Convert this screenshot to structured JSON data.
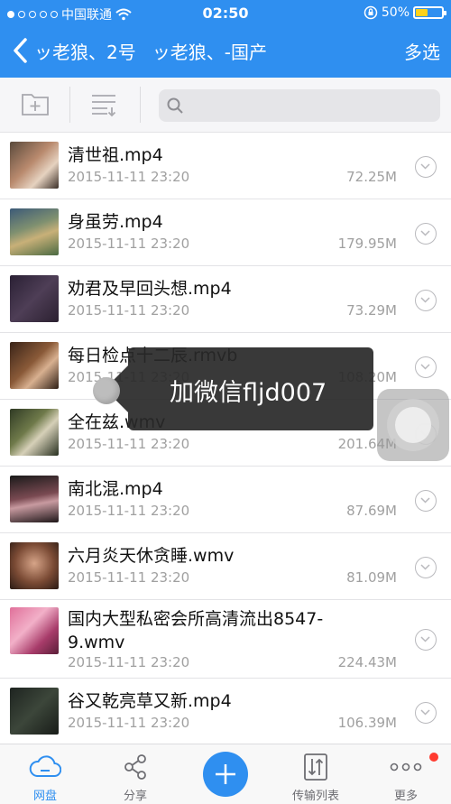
{
  "status": {
    "carrier": "中国联通",
    "time": "02:50",
    "battery": "50%",
    "battery_level": 0.5
  },
  "header": {
    "crumb1": "ッ老狼、2号",
    "crumb2": "ッ老狼、-国产",
    "multi_select": "多选"
  },
  "toolbar": {
    "search_placeholder": ""
  },
  "files": [
    {
      "name": "清世祖.mp4",
      "date": "2015-11-11 23:20",
      "size": "72.25M"
    },
    {
      "name": "身虽劳.mp4",
      "date": "2015-11-11 23:20",
      "size": "179.95M"
    },
    {
      "name": "劝君及早回头想.mp4",
      "date": "2015-11-11 23:20",
      "size": "73.29M"
    },
    {
      "name": "每日检点十二辰.rmvb",
      "date": "2015-11-11 23:20",
      "size": "108.20M"
    },
    {
      "name": "全在兹.wmv",
      "date": "2015-11-11 23:20",
      "size": "201.64M"
    },
    {
      "name": "南北混.mp4",
      "date": "2015-11-11 23:20",
      "size": "87.69M"
    },
    {
      "name": "六月炎天休贪睡.wmv",
      "date": "2015-11-11 23:20",
      "size": "81.09M"
    },
    {
      "name": "国内大型私密会所高清流出8547-9.wmv",
      "date": "2015-11-11 23:20",
      "size": "224.43M"
    },
    {
      "name": "谷又乾亮草又新.mp4",
      "date": "2015-11-11 23:20",
      "size": "106.39M"
    }
  ],
  "toast": {
    "text": "加微信fljd007"
  },
  "tabs": {
    "disk": "网盘",
    "share": "分享",
    "transfer": "传输列表",
    "more": "更多"
  },
  "colors": {
    "accent": "#2f8ff0",
    "badge": "#ff3b30"
  }
}
